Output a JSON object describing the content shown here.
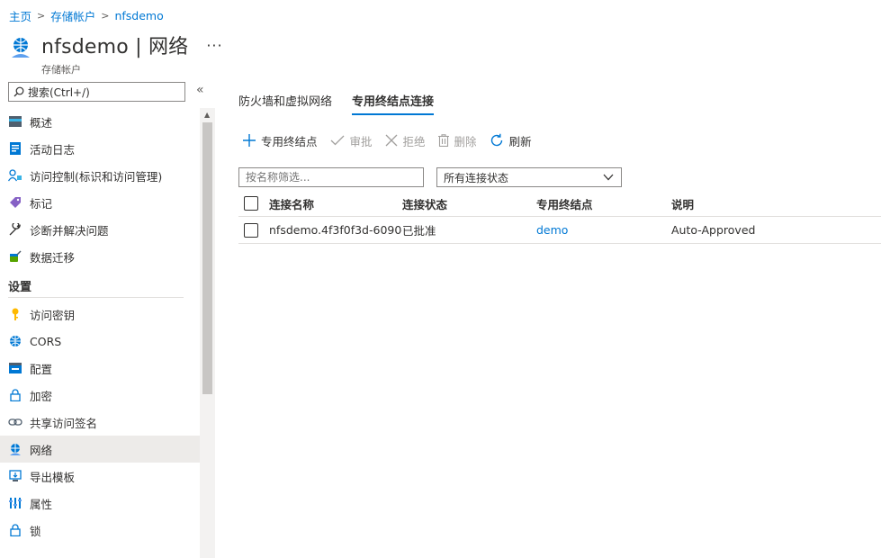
{
  "breadcrumb": {
    "home": "主页",
    "storage": "存储帐户",
    "current": "nfsdemo"
  },
  "header": {
    "title": "nfsdemo | 网络",
    "subtitle": "存储帐户",
    "more": "···"
  },
  "search": {
    "placeholder": "搜索(Ctrl+/)",
    "collapse": "«"
  },
  "sidebar": {
    "items": [
      {
        "label": "概述",
        "icon": "overview-icon"
      },
      {
        "label": "活动日志",
        "icon": "activity-log-icon"
      },
      {
        "label": "访问控制(标识和访问管理)",
        "icon": "access-control-icon"
      },
      {
        "label": "标记",
        "icon": "tag-icon"
      },
      {
        "label": "诊断并解决问题",
        "icon": "wrench-icon"
      },
      {
        "label": "数据迁移",
        "icon": "data-migration-icon"
      }
    ],
    "settings_heading": "设置",
    "settings_items": [
      {
        "label": "访问密钥",
        "icon": "key-icon"
      },
      {
        "label": "CORS",
        "icon": "cors-icon"
      },
      {
        "label": "配置",
        "icon": "configuration-icon"
      },
      {
        "label": "加密",
        "icon": "lock-icon"
      },
      {
        "label": "共享访问签名",
        "icon": "link-icon"
      },
      {
        "label": "网络",
        "icon": "network-icon",
        "active": true
      },
      {
        "label": "导出模板",
        "icon": "export-template-icon"
      },
      {
        "label": "属性",
        "icon": "properties-icon"
      },
      {
        "label": "锁",
        "icon": "lock-icon"
      }
    ]
  },
  "tabs": [
    {
      "label": "防火墙和虚拟网络",
      "active": false
    },
    {
      "label": "专用终结点连接",
      "active": true
    }
  ],
  "toolbar": {
    "add": "专用终结点",
    "approve": "审批",
    "reject": "拒绝",
    "delete": "删除",
    "refresh": "刷新"
  },
  "filter": {
    "name_placeholder": "按名称筛选...",
    "status_selected": "所有连接状态"
  },
  "table": {
    "headers": {
      "name": "连接名称",
      "state": "连接状态",
      "endpoint": "专用终结点",
      "description": "说明"
    },
    "rows": [
      {
        "name": "nfsdemo.4f3f0f3d-6090-...",
        "state": "已批准",
        "endpoint": "demo",
        "description": "Auto-Approved"
      }
    ]
  },
  "colors": {
    "accent": "#0078d4",
    "active_bg": "#edebe9",
    "text": "#323130"
  }
}
